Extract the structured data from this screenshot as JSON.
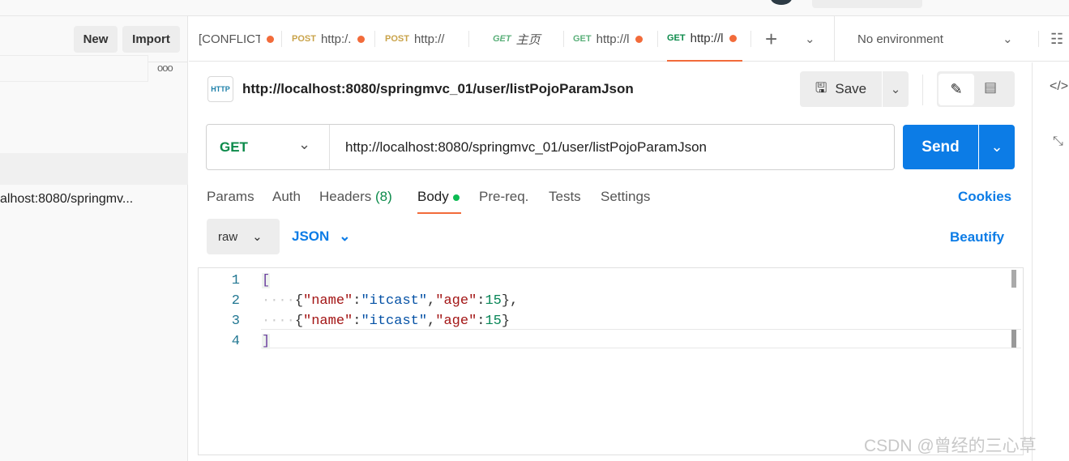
{
  "sidebar": {
    "new_label": "New",
    "import_label": "Import",
    "more": "ooo",
    "item": "alhost:8080/springmv..."
  },
  "tabs": [
    {
      "method": "",
      "label": "[CONFLICT",
      "dot": true
    },
    {
      "method": "POST",
      "label": "http:/.",
      "dot": true
    },
    {
      "method": "POST",
      "label": "http://",
      "dot": false
    },
    {
      "method": "GET",
      "label": "主页",
      "dot": false
    },
    {
      "method": "GET",
      "label": "http://l",
      "dot": true
    },
    {
      "method": "GET",
      "label": "http://l",
      "dot": true,
      "active": true
    }
  ],
  "environment": "No environment",
  "request": {
    "title": "http://localhost:8080/springmvc_01/user/listPojoParamJson",
    "method": "GET",
    "url": "http://localhost:8080/springmvc_01/user/listPojoParamJson",
    "save": "Save",
    "send": "Send"
  },
  "subtabs": {
    "params": "Params",
    "auth": "Auth",
    "headers": "Headers",
    "headers_count": "(8)",
    "body": "Body",
    "prereq": "Pre-req.",
    "tests": "Tests",
    "settings": "Settings",
    "cookies": "Cookies"
  },
  "body": {
    "mode": "raw",
    "format": "JSON",
    "beautify": "Beautify",
    "lines": [
      "1",
      "2",
      "3",
      "4"
    ]
  },
  "watermark": "CSDN @曾经的三心草",
  "colors": {
    "accent": "#0c7ce6",
    "orange": "#f26b3a",
    "get": "#0b8a4a",
    "post": "#c9a34a"
  }
}
